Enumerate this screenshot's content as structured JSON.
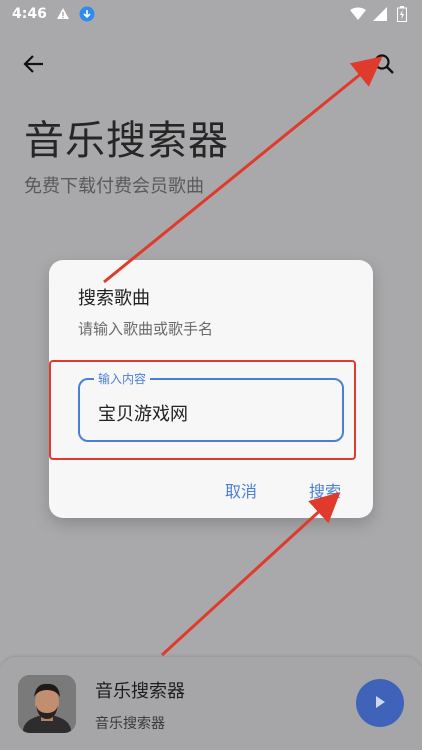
{
  "status_bar": {
    "time": "4:46",
    "icons_left": [
      "warning-icon",
      "download-icon"
    ],
    "icons_right": [
      "wifi-icon",
      "signal-icon",
      "battery-icon"
    ]
  },
  "header": {
    "back_icon": "arrow-left-icon",
    "search_icon": "search-icon",
    "title": "音乐搜索器",
    "subtitle": "免费下载付费会员歌曲"
  },
  "dialog": {
    "title": "搜索歌曲",
    "hint": "请输入歌曲或歌手名",
    "input_label": "输入内容",
    "input_value": "宝贝游戏网",
    "cancel_label": "取消",
    "search_label": "搜索"
  },
  "player": {
    "title": "音乐搜索器",
    "subtitle": "音乐搜索器",
    "play_icon": "play-icon"
  },
  "colors": {
    "accent": "#4a7fd6",
    "annotation": "#e03a2c",
    "scrim": "#a9a9ab",
    "play": "#3e63b8"
  }
}
